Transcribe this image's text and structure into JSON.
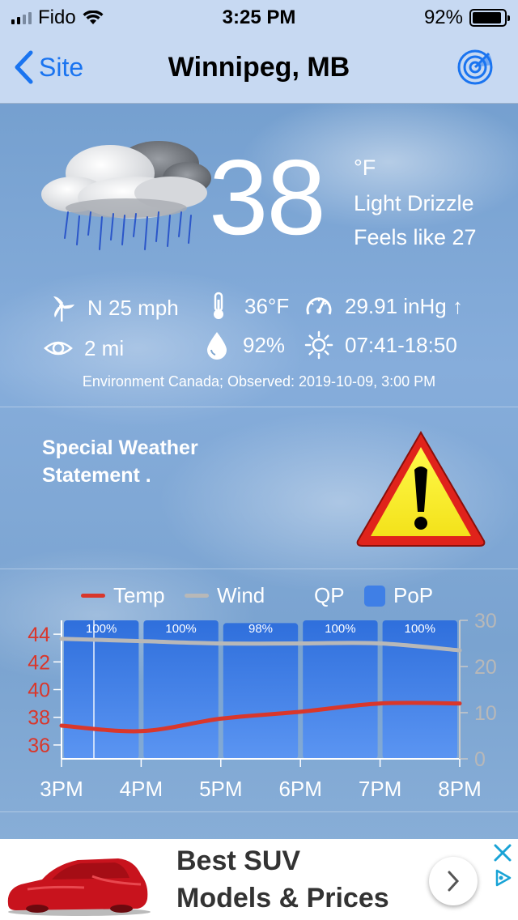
{
  "status_bar": {
    "carrier": "Fido",
    "time": "3:25 PM",
    "battery_percent": "92%",
    "battery_level": 0.92,
    "signal_bars": 2
  },
  "nav": {
    "back_label": "Site",
    "title": "Winnipeg, MB",
    "radar_icon": "radar-icon",
    "accent_color": "#1a74f0"
  },
  "current": {
    "temperature": "38",
    "unit": "°F",
    "condition": "Light Drizzle",
    "feels_like": "Feels like 27",
    "icon": "cloud-drizzle-icon"
  },
  "metrics": {
    "wind": "N 25 mph",
    "dewpoint": "36°F",
    "pressure": "29.91 inHg ↑",
    "visibility": "2 mi",
    "humidity": "92%",
    "sun": "07:41-18:50"
  },
  "source": "Environment Canada; Observed: 2019-10-09, 3:00 PM",
  "alert": {
    "text": "Special Weather Statement .",
    "icon": "warning-icon"
  },
  "legend": {
    "temp": "Temp",
    "wind": "Wind",
    "qp": "QP",
    "pop": "PoP"
  },
  "chart_data": {
    "type": "line",
    "x": [
      "3PM",
      "4PM",
      "5PM",
      "6PM",
      "7PM",
      "8PM"
    ],
    "series": [
      {
        "name": "Temp",
        "axis": "left",
        "color": "#d9372b",
        "values": [
          37.4,
          37.0,
          37.9,
          38.4,
          39.0,
          39.0
        ]
      },
      {
        "name": "Wind",
        "axis": "right",
        "color": "#b8b8b8",
        "values": [
          26,
          25.5,
          25,
          25,
          25,
          23.5
        ]
      },
      {
        "name": "PoP",
        "type": "bar",
        "color": "#3f7fe6",
        "values": [
          100,
          100,
          98,
          100,
          100
        ],
        "labels": [
          "100%",
          "100%",
          "98%",
          "100%",
          "100%"
        ]
      }
    ],
    "y_left": {
      "ticks": [
        36,
        38,
        40,
        42,
        44
      ],
      "range": [
        35,
        45
      ],
      "color": "#d9372b"
    },
    "y_right": {
      "ticks": [
        0,
        10,
        20,
        30
      ],
      "range": [
        0,
        30
      ],
      "color": "#b8b8b8"
    },
    "grid": false
  },
  "ad": {
    "headline_line1": "Best SUV",
    "headline_line2": "Models & Prices"
  }
}
